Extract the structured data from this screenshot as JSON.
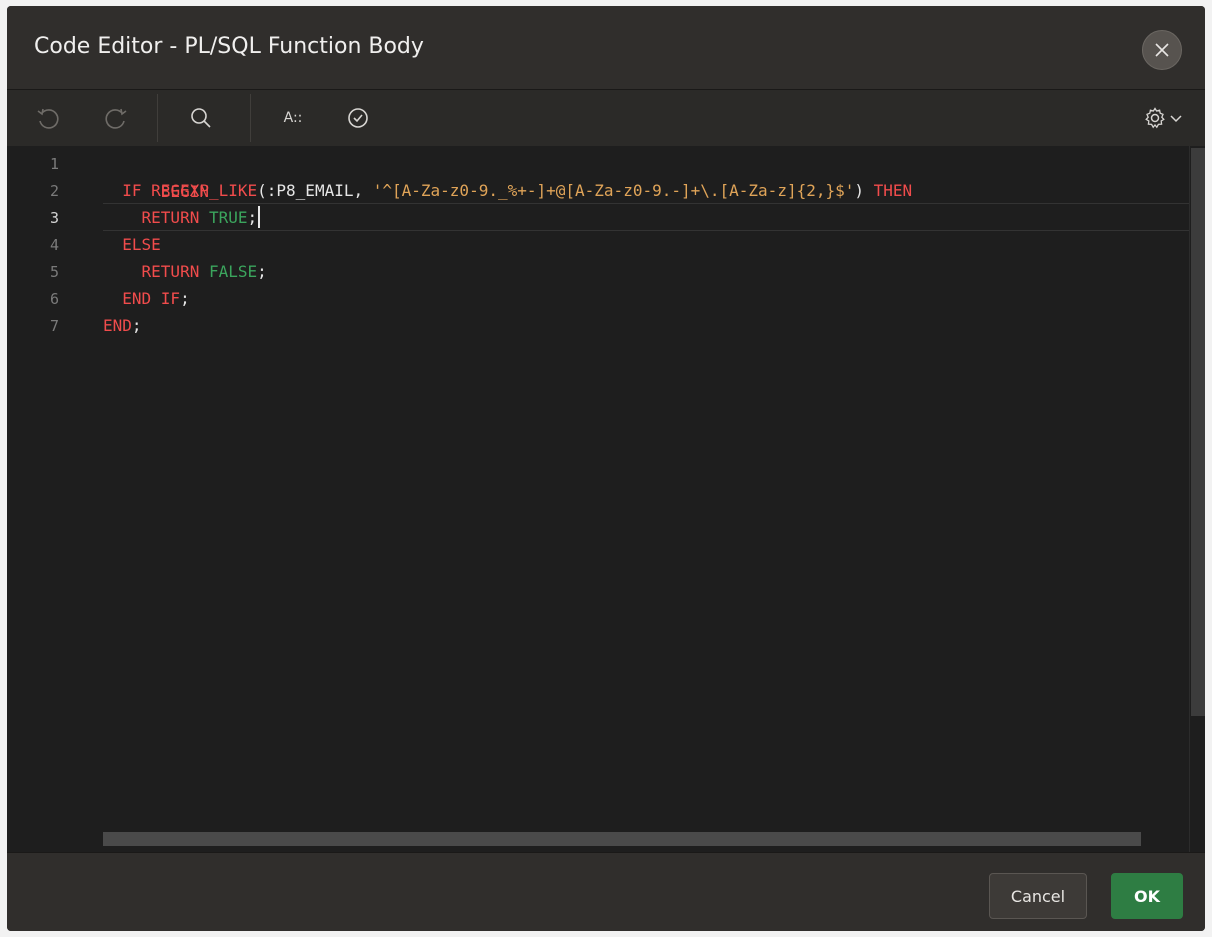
{
  "dialog": {
    "title": "Code Editor - PL/SQL Function Body"
  },
  "toolbar": {
    "icons": [
      "undo-icon",
      "redo-icon",
      "search-icon",
      "autocomplete-icon",
      "validate-icon",
      "settings-icon",
      "chevron-down-icon"
    ],
    "autocomplete_label": "A::"
  },
  "editor": {
    "active_line": 3,
    "line_numbers": [
      "1",
      "2",
      "3",
      "4",
      "5",
      "6",
      "7"
    ],
    "lines": [
      [
        {
          "t": "BEGIN",
          "c": "kw"
        }
      ],
      [
        {
          "t": "  IF ",
          "c": "kw"
        },
        {
          "t": "REGEXP_LIKE",
          "c": "kw"
        },
        {
          "t": "(:P8_EMAIL, ",
          "c": "punct"
        },
        {
          "t": "'^[A-Za-z0-9._%+-]+@[A-Za-z0-9.-]+\\.[A-Za-z]{2,}$'",
          "c": "str"
        },
        {
          "t": ") ",
          "c": "punct"
        },
        {
          "t": "THEN",
          "c": "kw"
        }
      ],
      [
        {
          "t": "    RETURN ",
          "c": "kw"
        },
        {
          "t": "TRUE",
          "c": "lit"
        },
        {
          "t": ";",
          "c": "punct"
        }
      ],
      [
        {
          "t": "  ELSE",
          "c": "kw"
        }
      ],
      [
        {
          "t": "    RETURN ",
          "c": "kw"
        },
        {
          "t": "FALSE",
          "c": "lit"
        },
        {
          "t": ";",
          "c": "punct"
        }
      ],
      [
        {
          "t": "  END IF",
          "c": "kw"
        },
        {
          "t": ";",
          "c": "punct"
        }
      ],
      [
        {
          "t": "END",
          "c": "kw"
        },
        {
          "t": ";",
          "c": "punct"
        }
      ]
    ]
  },
  "footer": {
    "cancel_label": "Cancel",
    "ok_label": "OK"
  },
  "colors": {
    "keyword": "#f14c4c",
    "string": "#e0a458",
    "literal": "#3ba55d",
    "ok_button": "#2e7d43"
  }
}
